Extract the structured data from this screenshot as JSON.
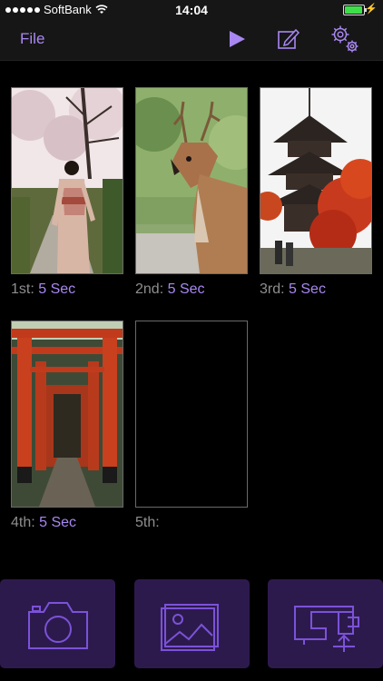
{
  "status": {
    "carrier": "SoftBank",
    "time": "14:04",
    "battery_level": 0.95
  },
  "nav": {
    "file_label": "File",
    "accent": "#a987f2"
  },
  "slides": [
    {
      "label": "1st:",
      "duration": "5 Sec",
      "image": "kimono-woman-cherry-blossoms"
    },
    {
      "label": "2nd:",
      "duration": "5 Sec",
      "image": "deer"
    },
    {
      "label": "3rd:",
      "duration": "5 Sec",
      "image": "pagoda-autumn-maples"
    },
    {
      "label": "4th:",
      "duration": "5 Sec",
      "image": "torii-gates-tunnel"
    },
    {
      "label": "5th:",
      "duration": "",
      "image": ""
    }
  ],
  "buttons": [
    "camera-icon",
    "photo-library-icon",
    "sewing-machine-export-icon"
  ],
  "colors": {
    "accent": "#a987f2",
    "button_bg": "#2d1a4d",
    "button_stroke": "#7b52d8"
  }
}
